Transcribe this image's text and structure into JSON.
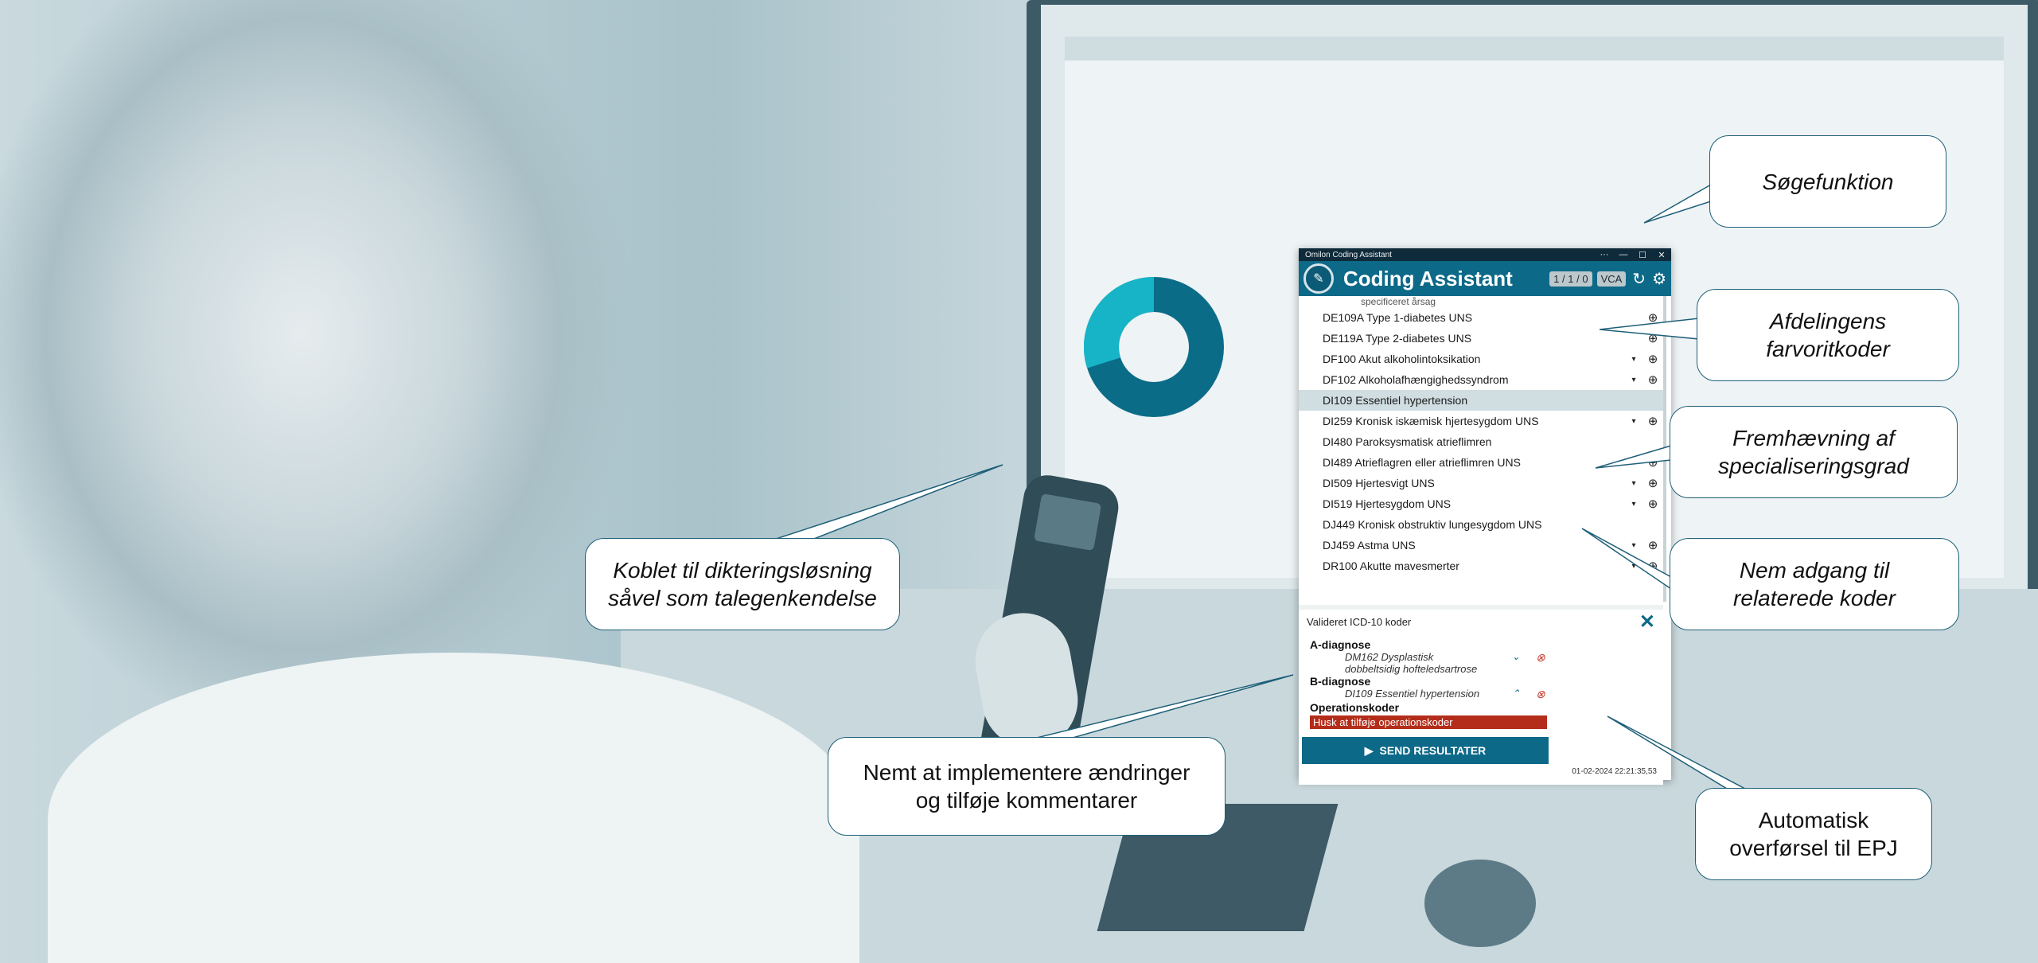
{
  "window": {
    "title": "Omilon Coding Assistant",
    "more": "···",
    "minimize": "—",
    "maximize": "☐",
    "close": "✕"
  },
  "header": {
    "title": "Coding Assistant",
    "counter": "1 / 1 / 0",
    "vca": "VCA",
    "refresh_icon": "↻",
    "settings_icon": "⚙"
  },
  "list": {
    "partial_row": "specificeret årsag",
    "items": [
      {
        "label": "DE109A Type 1-diabetes UNS",
        "caret": "",
        "plus": "⊕"
      },
      {
        "label": "DE119A Type 2-diabetes UNS",
        "caret": "",
        "plus": "⊕"
      },
      {
        "label": "DF100 Akut alkoholintoksikation",
        "caret": "▾",
        "plus": "⊕"
      },
      {
        "label": "DF102 Alkoholafhængighedssyndrom",
        "caret": "▾",
        "plus": "⊕"
      },
      {
        "label": "DI109 Essentiel hypertension",
        "caret": "",
        "plus": ""
      },
      {
        "label": "DI259 Kronisk iskæmisk hjertesygdom UNS",
        "caret": "▾",
        "plus": "⊕"
      },
      {
        "label": "DI480 Paroksysmatisk atrieflimren",
        "caret": "",
        "plus": ""
      },
      {
        "label": "DI489 Atrieflagren eller atrieflimren UNS",
        "caret": "▾",
        "plus": "⊕"
      },
      {
        "label": "DI509 Hjertesvigt UNS",
        "caret": "▾",
        "plus": "⊕"
      },
      {
        "label": "DI519 Hjertesygdom UNS",
        "caret": "▾",
        "plus": "⊕"
      },
      {
        "label": "DJ449 Kronisk obstruktiv lungesygdom UNS",
        "caret": "",
        "plus": ""
      },
      {
        "label": "DJ459 Astma UNS",
        "caret": "▾",
        "plus": "⊕"
      },
      {
        "label": "DR100 Akutte mavesmerter",
        "caret": "▾",
        "plus": "⊕"
      }
    ]
  },
  "validated": {
    "title": "Valideret ICD-10 koder",
    "close_icon": "✕",
    "a_label": "A-diagnose",
    "a_code_line1": "DM162 Dysplastisk",
    "a_code_line2": "dobbeltsidig hofteledsartrose",
    "a_chevron": "⌄",
    "b_label": "B-diagnose",
    "b_code": "DI109 Essentiel hypertension",
    "b_chevron": "⌃",
    "remove_icon": "⊗",
    "op_label": "Operationskoder",
    "warning": "Husk at tilføje operationskoder",
    "send_label": "SEND RESULTATER",
    "send_icon": "▶",
    "timestamp": "01-02-2024 22:21:35,53"
  },
  "callouts": {
    "sogefunktion": "Søgefunktion",
    "afdelingens_1": "Afdelingens",
    "afdelingens_2": "farvoritkoder",
    "fremhaevning_1": "Fremhævning af",
    "fremhaevning_2": "specialiseringsgrad",
    "nem_1": "Nem adgang til",
    "nem_2": "relaterede koder",
    "koblet_1": "Koblet til dikteringsløsning",
    "koblet_2": "såvel som talegenkendelse",
    "nemt_1": "Nemt at implementere ændringer",
    "nemt_2": "og tilføje kommentarer",
    "auto_1": "Automatisk",
    "auto_2": "overførsel til  EPJ"
  },
  "colors": {
    "accent": "#0d6988",
    "titlebar": "#0f2a3a",
    "warning": "#b32d1a",
    "donut_dark": "#0b6c88",
    "donut_light": "#19c1d1"
  }
}
